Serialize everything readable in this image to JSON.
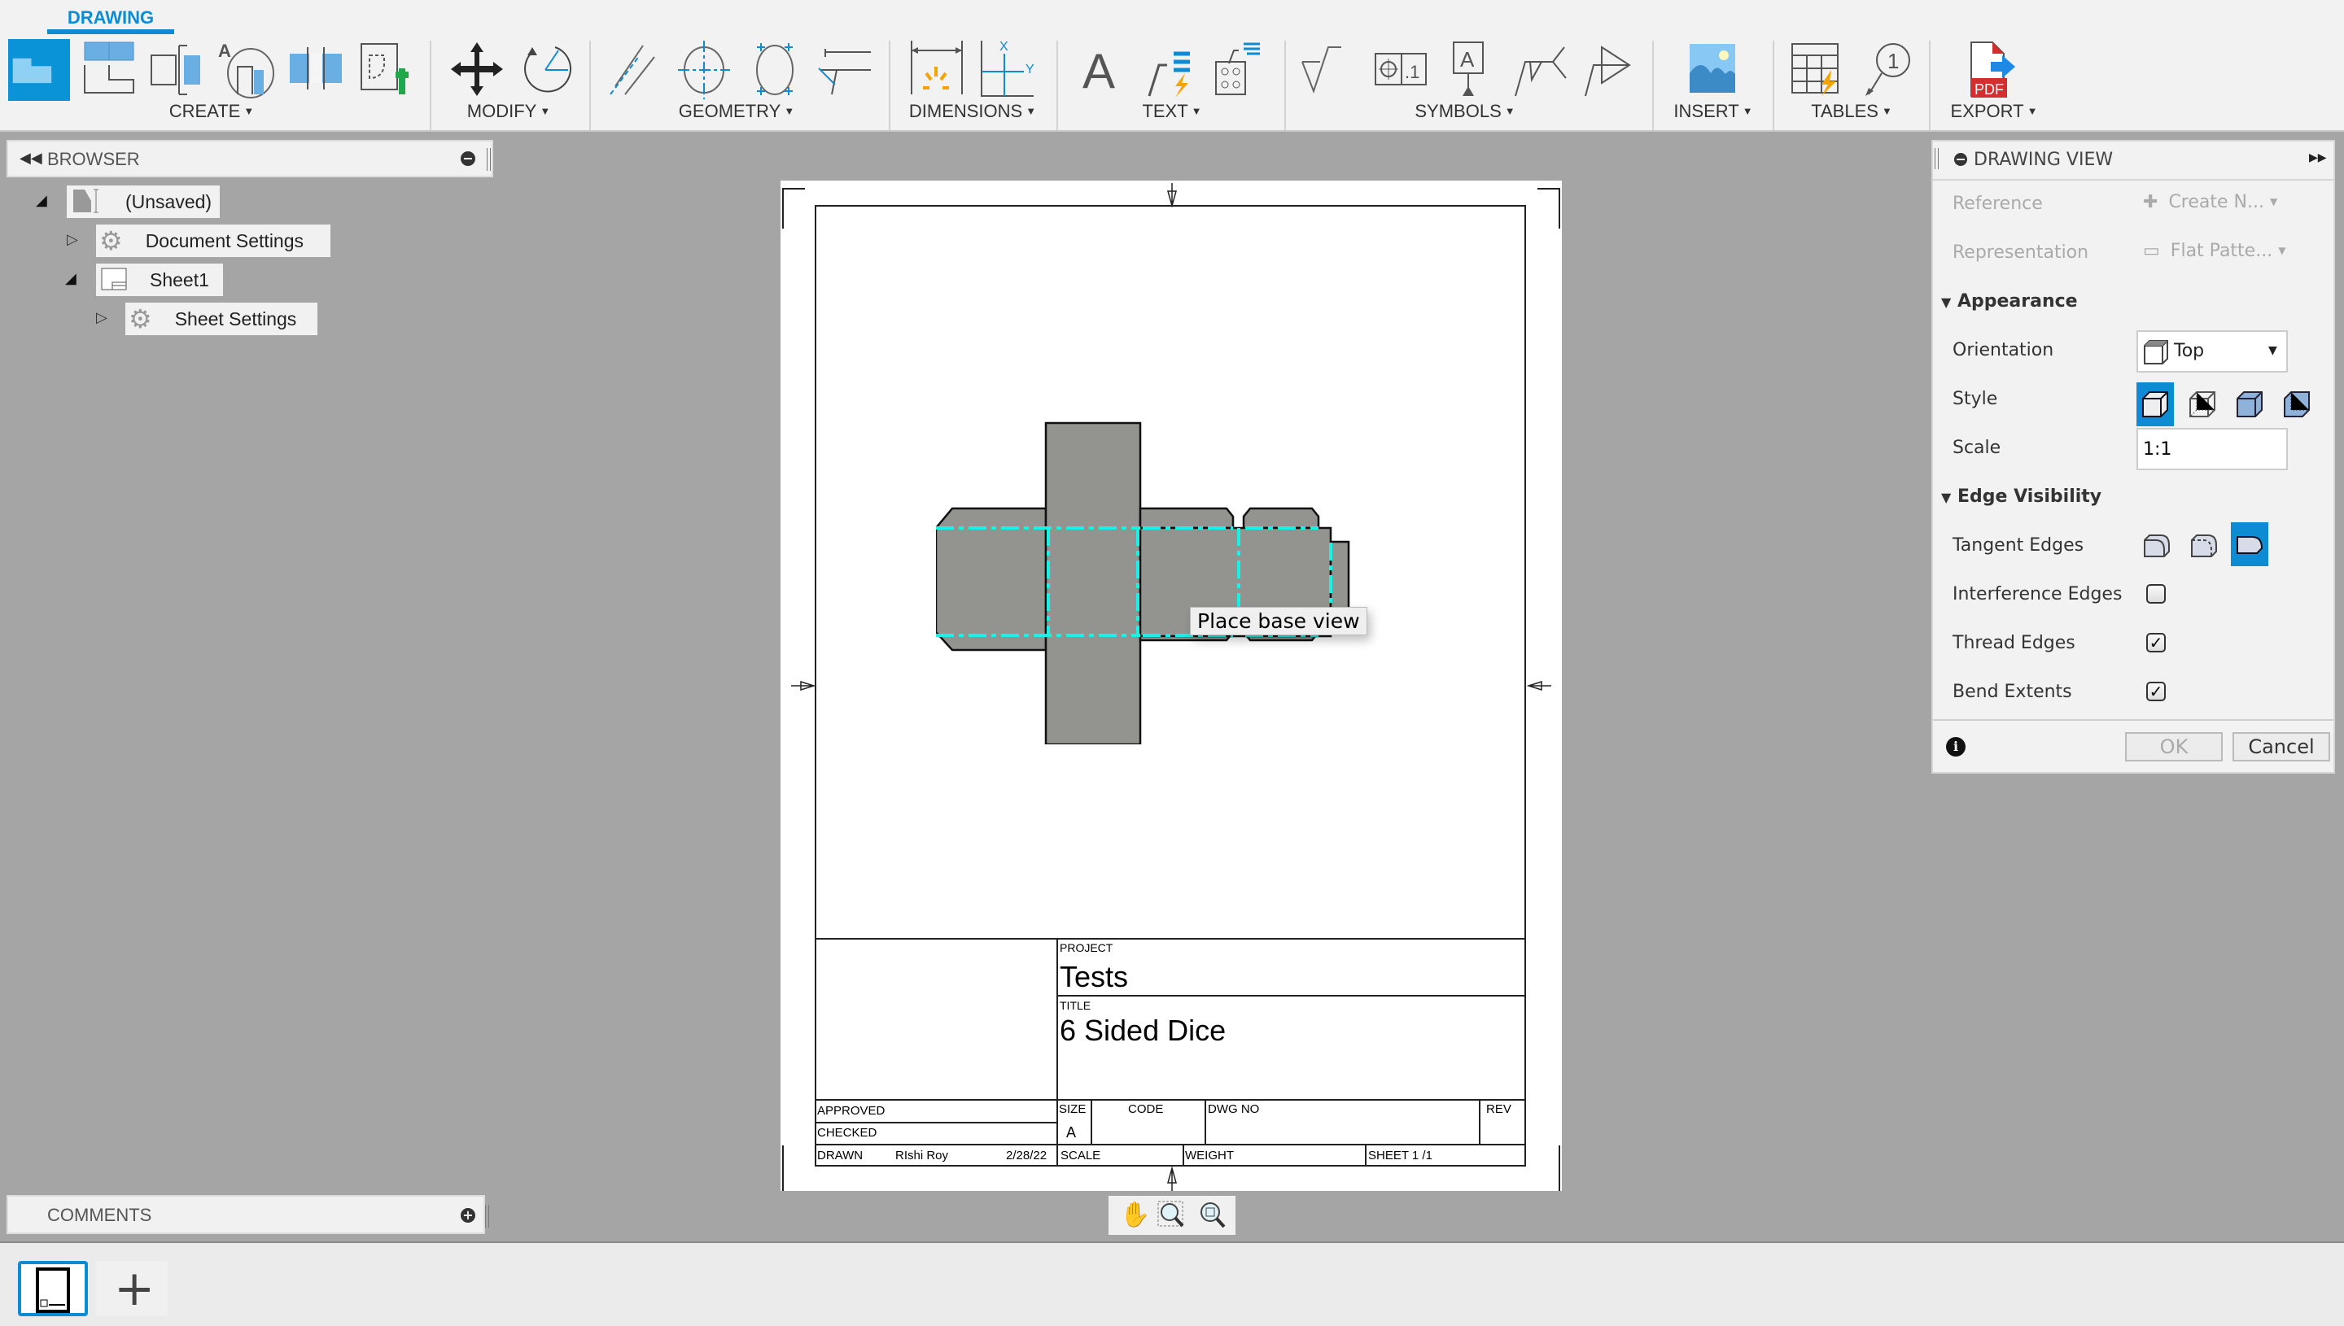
{
  "ribbon": {
    "active_tab": "DRAWING",
    "groups": [
      {
        "label": "CREATE",
        "tools": [
          "base-view-icon",
          "projected-view-icon",
          "section-view-icon",
          "detail-view-icon",
          "break-view-icon",
          "sketch-icon"
        ]
      },
      {
        "label": "MODIFY",
        "tools": [
          "move-icon",
          "rotate-icon"
        ]
      },
      {
        "label": "GEOMETRY",
        "tools": [
          "centerline-icon",
          "center-mark-icon",
          "center-mark-pattern-icon",
          "edge-extension-icon"
        ]
      },
      {
        "label": "DIMENSIONS",
        "tools": [
          "dimension-icon",
          "ordinate-dimension-icon"
        ]
      },
      {
        "label": "TEXT",
        "tools": [
          "text-icon",
          "leader-icon",
          "hole-callout-icon"
        ]
      },
      {
        "label": "SYMBOLS",
        "tools": [
          "surface-texture-icon",
          "feature-control-frame-icon",
          "datum-identifier-icon",
          "welding-symbol-icon",
          "edge-symbol-icon"
        ]
      },
      {
        "label": "INSERT",
        "tools": [
          "insert-image-icon"
        ]
      },
      {
        "label": "TABLES",
        "tools": [
          "table-icon",
          "balloon-icon"
        ]
      },
      {
        "label": "EXPORT",
        "tools": [
          "pdf-export-icon"
        ]
      }
    ]
  },
  "browser": {
    "title": "BROWSER",
    "nodes": [
      {
        "label": "(Unsaved)",
        "icon": "drawing-doc-icon",
        "expanded": true
      },
      {
        "label": "Document Settings",
        "icon": "gear-icon",
        "expanded": false
      },
      {
        "label": "Sheet1",
        "icon": "sheet-icon",
        "expanded": true
      },
      {
        "label": "Sheet Settings",
        "icon": "gear-icon",
        "expanded": false
      }
    ]
  },
  "comments": {
    "title": "COMMENTS"
  },
  "canvas": {
    "tooltip": "Place base view",
    "colors": {
      "part_fill": "#939490",
      "bend_line": "#19f0e6"
    }
  },
  "title_block": {
    "project_label": "PROJECT",
    "project": "Tests",
    "title_label": "TITLE",
    "title": "6 Sided Dice",
    "approved_label": "APPROVED",
    "checked_label": "CHECKED",
    "drawn_label": "DRAWN",
    "drawn_by": "RIshi Roy",
    "drawn_date": "2/28/22",
    "size_label": "SIZE",
    "size": "A",
    "code_label": "CODE",
    "dwg_no_label": "DWG NO",
    "rev_label": "REV",
    "scale_label": "SCALE",
    "weight_label": "WEIGHT",
    "sheet_label": "SHEET 1 /1"
  },
  "drawing_view": {
    "title": "DRAWING VIEW",
    "reference_label": "Reference",
    "reference_value": "Create N...",
    "representation_label": "Representation",
    "representation_value": "Flat Patte...",
    "appearance_label": "Appearance",
    "orientation_label": "Orientation",
    "orientation_value": "Top",
    "style_label": "Style",
    "style_options": [
      "visible-edges",
      "visible-and-hidden-edges",
      "shaded",
      "shaded-with-hidden-edges"
    ],
    "style_selected": 0,
    "scale_label": "Scale",
    "scale_value": "1:1",
    "edge_visibility_label": "Edge Visibility",
    "tangent_edges_label": "Tangent Edges",
    "tangent_selected": 2,
    "interference_edges_label": "Interference Edges",
    "interference_edges": false,
    "thread_edges_label": "Thread Edges",
    "thread_edges": true,
    "bend_extents_label": "Bend Extents",
    "bend_extents": true,
    "ok_label": "OK",
    "cancel_label": "Cancel",
    "accent": "#0d8bd3"
  }
}
